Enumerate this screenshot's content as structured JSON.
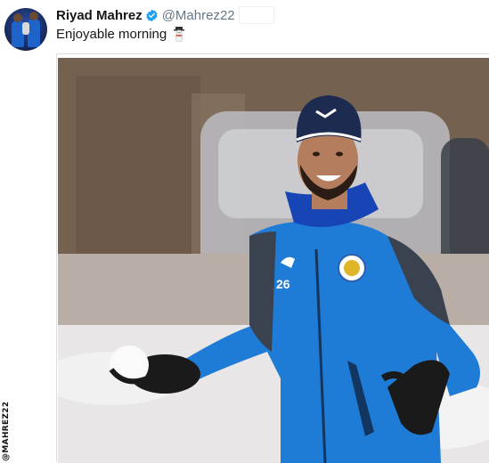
{
  "tweet": {
    "name": "Riyad Mahrez",
    "handle": "@Mahrez22",
    "text": "Enjoyable morning",
    "emoji_icon": "snowman-icon",
    "verified_icon": "verified-badge-icon"
  },
  "photo": {
    "credit": "@MAHREZ22",
    "shirt_number": "26"
  },
  "colors": {
    "name": "#14171a",
    "handle": "#657786",
    "verified": "#1da1f2",
    "kit_blue": "#1e7bd6"
  }
}
